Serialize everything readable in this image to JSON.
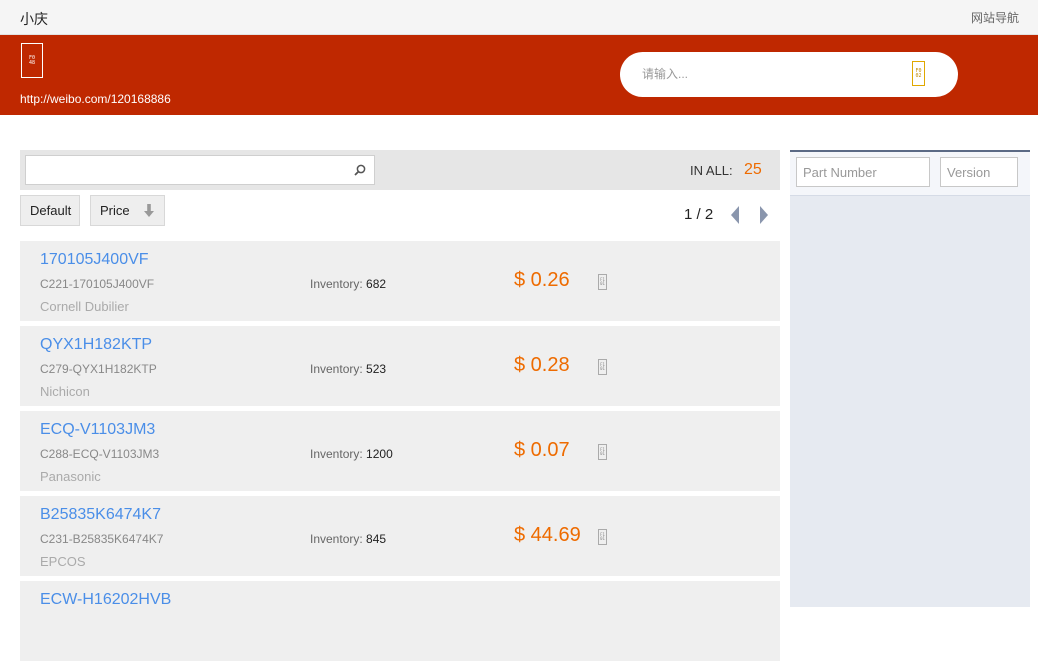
{
  "topbar": {
    "brand": "小庆",
    "site_nav": "网站导航"
  },
  "header": {
    "logo_glyph": "F048",
    "link": "http://weibo.com/120168886",
    "search_placeholder": "请输入...",
    "search_glyph": "F002",
    "color": "#bf2800"
  },
  "filter": {
    "input_value": "",
    "inall_label": "IN ALL:",
    "inall_count": "25"
  },
  "sort": {
    "default_label": "Default",
    "price_label": "Price"
  },
  "pager": {
    "current": "1",
    "separator": "/",
    "total": "2",
    "text": "1 / 2"
  },
  "accent_color": "#ee6b00",
  "link_color": "#4a8ee8",
  "icons": {
    "row_cart": "F101",
    "filter_search": "search-icon",
    "sort_arrow": "arrow-down-icon"
  },
  "parts": [
    {
      "part_number": "170105J400VF",
      "code": "C221-170105J400VF",
      "maker": "Cornell Dubilier",
      "inventory_label": "Inventory:",
      "inventory": "682",
      "price": "$  0.26"
    },
    {
      "part_number": "QYX1H182KTP",
      "code": "C279-QYX1H182KTP",
      "maker": "Nichicon",
      "inventory_label": "Inventory:",
      "inventory": "523",
      "price": "$  0.28"
    },
    {
      "part_number": "ECQ-V1103JM3",
      "code": "C288-ECQ-V1103JM3",
      "maker": "Panasonic",
      "inventory_label": "Inventory:",
      "inventory": "1200",
      "price": "$  0.07"
    },
    {
      "part_number": "B25835K6474K7",
      "code": "C231-B25835K6474K7",
      "maker": "EPCOS",
      "inventory_label": "Inventory:",
      "inventory": "845",
      "price": "$  44.69"
    },
    {
      "part_number": "ECW-H16202HVB",
      "code": "",
      "maker": "",
      "inventory_label": "",
      "inventory": "",
      "price": ""
    }
  ],
  "side": {
    "part_number_placeholder": "Part Number",
    "version_placeholder": "Version"
  }
}
